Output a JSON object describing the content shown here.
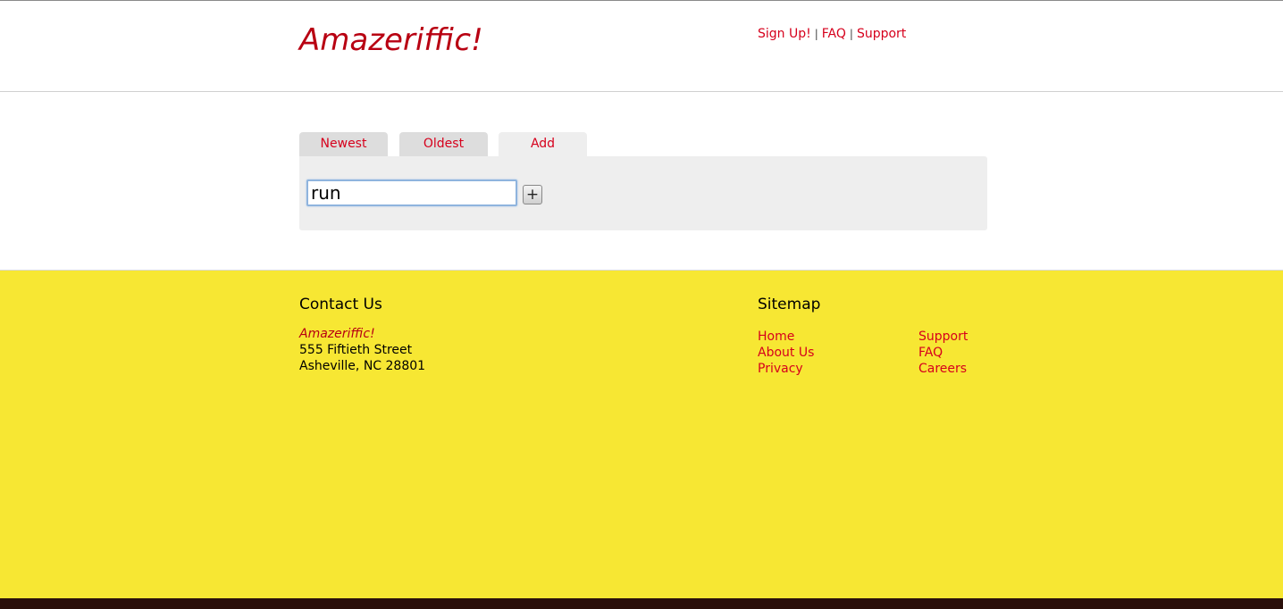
{
  "header": {
    "logo": "Amazeriffic!",
    "nav": [
      "Sign Up!",
      "FAQ",
      "Support"
    ],
    "separator": "|"
  },
  "tabs": [
    "Newest",
    "Oldest",
    "Add"
  ],
  "active_tab": "Add",
  "add_panel": {
    "input_value": "run",
    "add_button_label": "+"
  },
  "footer": {
    "contact": {
      "heading": "Contact Us",
      "company": "Amazeriffic!",
      "street": "555 Fiftieth Street",
      "city": "Asheville, NC 28801"
    },
    "sitemap": {
      "heading": "Sitemap",
      "col1": [
        "Home",
        "About Us",
        "Privacy"
      ],
      "col2": [
        "Support",
        "FAQ",
        "Careers"
      ]
    }
  },
  "colors": {
    "accent": "#d6001c",
    "logo": "#b80012",
    "footer_bg": "#f7e733"
  }
}
